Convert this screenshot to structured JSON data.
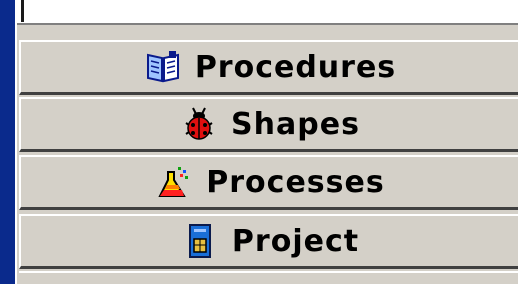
{
  "nav": {
    "buttons": [
      {
        "label": "Procedures",
        "icon": "book-icon"
      },
      {
        "label": "Shapes",
        "icon": "ladybug-icon"
      },
      {
        "label": "Processes",
        "icon": "flask-icon"
      },
      {
        "label": "Project",
        "icon": "sim-card-icon"
      }
    ]
  },
  "colors": {
    "window_bg": "#0a2a8c",
    "panel_bg": "#d4d0c8"
  }
}
